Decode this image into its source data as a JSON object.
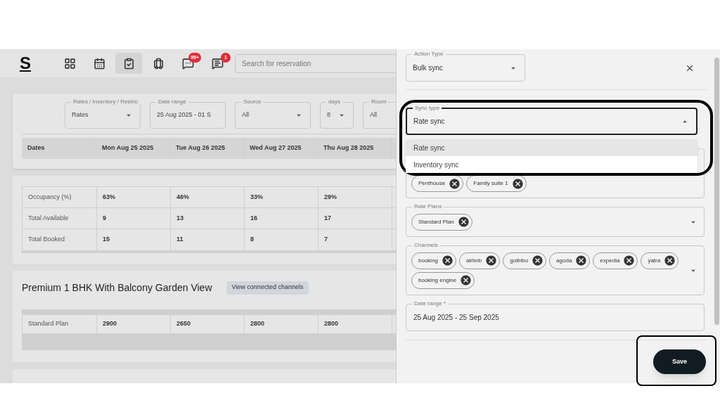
{
  "header": {
    "logo": "S",
    "nav": [
      {
        "selected": false
      },
      {
        "selected": false
      },
      {
        "selected": true
      },
      {
        "selected": false
      },
      {
        "selected": false,
        "badge": "99+"
      },
      {
        "selected": false,
        "badge": "1"
      }
    ],
    "search": {
      "placeholder": "Search for reservation"
    }
  },
  "filters": [
    {
      "label": "Rates / Inventory / Restric",
      "value": "Rates",
      "dropdown": true
    },
    {
      "label": "Date range",
      "value": "25 Aug 2025 - 01 S",
      "dropdown": false
    },
    {
      "label": "Source",
      "value": "All",
      "dropdown": true
    },
    {
      "label": "days",
      "value": "8",
      "dropdown": true
    },
    {
      "label": "Room",
      "value": "All",
      "dropdown": false
    }
  ],
  "dates_table": {
    "columns": [
      "Dates",
      "Mon Aug 25 2025",
      "Tue Aug 26 2025",
      "Wed Aug 27 2025",
      "Thu Aug 28 2025"
    ]
  },
  "stats": [
    {
      "label": "Occupancy (%)",
      "values": [
        "63%",
        "46%",
        "33%",
        "29%"
      ]
    },
    {
      "label": "Total Available",
      "values": [
        "9",
        "13",
        "16",
        "17"
      ]
    },
    {
      "label": "Total Booked",
      "values": [
        "15",
        "11",
        "8",
        "7"
      ]
    }
  ],
  "room": {
    "title": "Premium 1 BHK With Balcony Garden View",
    "button": "View connected channels",
    "rows": [
      {
        "label": "Standard Plan",
        "values": [
          "2900",
          "2650",
          "2800",
          "2800"
        ]
      }
    ]
  },
  "drawer": {
    "action_type": {
      "label": "Action Type",
      "value": "Bulk sync"
    },
    "sync_type": {
      "label": "Sync type",
      "value": "Rate sync",
      "expanded": true,
      "highlighted": true,
      "options": [
        {
          "label": "Rate sync",
          "selected": true
        },
        {
          "label": "Inventory sync",
          "selected": false
        }
      ]
    },
    "room_types": {
      "chips": [
        "Penthouse",
        "Family suite 1"
      ]
    },
    "rate_plans": {
      "label": "Rate Plans",
      "chips": [
        "Standard Plan"
      ]
    },
    "channels": {
      "label": "Channels",
      "chips": [
        "booking",
        "airbnb",
        "goibibo",
        "agoda",
        "expedia",
        "yatra",
        "booking engine"
      ]
    },
    "date_range": {
      "label": "Date range *",
      "value": "25 Aug 2025 - 25 Sep 2025"
    },
    "save": {
      "label": "Save",
      "highlighted": true
    }
  }
}
